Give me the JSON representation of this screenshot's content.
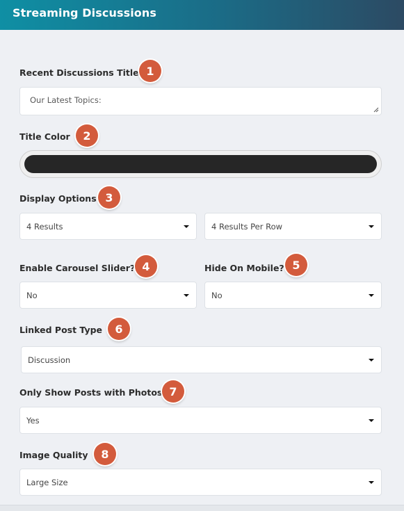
{
  "header": {
    "title": "Streaming Discussions"
  },
  "fields": {
    "recent_title": {
      "label": "Recent Discussions Title",
      "badge": "1",
      "value": "Our Latest Topics:"
    },
    "title_color": {
      "label": "Title Color",
      "badge": "2",
      "swatch": "#262626"
    },
    "display_options": {
      "label": "Display Options",
      "badge": "3",
      "results": "4 Results",
      "per_row": "4 Results Per Row"
    },
    "carousel": {
      "label": "Enable Carousel Slider?",
      "badge": "4",
      "value": "No"
    },
    "hide_mobile": {
      "label": "Hide On Mobile?",
      "badge": "5",
      "value": "No"
    },
    "linked_post_type": {
      "label": "Linked Post Type",
      "badge": "6",
      "value": "Discussion"
    },
    "only_photos": {
      "label": "Only Show Posts with Photos",
      "badge": "7",
      "value": "Yes"
    },
    "image_quality": {
      "label": "Image Quality",
      "badge": "8",
      "value": "Large Size"
    }
  },
  "colors": {
    "badge": "#d35b3c",
    "header_start": "#0f8fa4",
    "header_end": "#2c4a63"
  }
}
